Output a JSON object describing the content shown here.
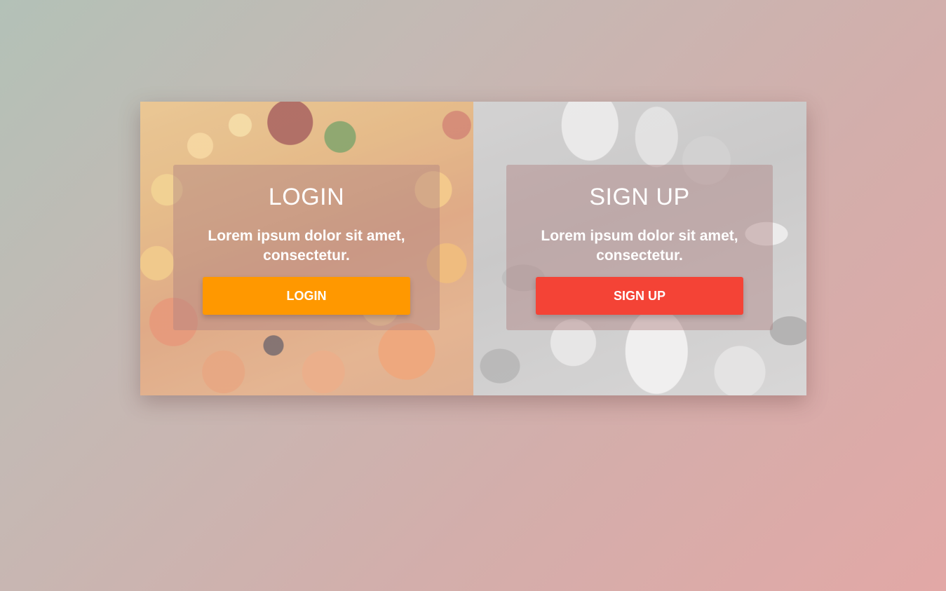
{
  "login": {
    "title": "LOGIN",
    "text": "Lorem ipsum dolor sit amet, consectetur.",
    "button_label": "LOGIN",
    "button_color": "#ff9800"
  },
  "signup": {
    "title": "SIGN UP",
    "text": "Lorem ipsum dolor sit amet, consectetur.",
    "button_label": "SIGN UP",
    "button_color": "#f44336"
  }
}
